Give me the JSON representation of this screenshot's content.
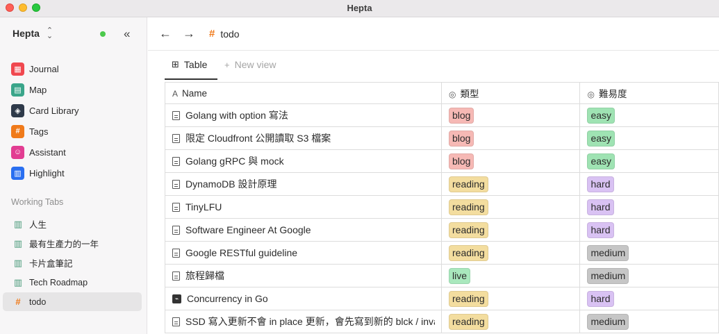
{
  "window": {
    "title": "Hepta"
  },
  "sidebar": {
    "workspace": "Hepta",
    "nav": [
      {
        "label": "Journal",
        "icon": "calendar-icon",
        "color": "#f0484f",
        "glyph": "▦"
      },
      {
        "label": "Map",
        "icon": "map-icon",
        "color": "#3aa58a",
        "glyph": "▤"
      },
      {
        "label": "Card Library",
        "icon": "stack-icon",
        "color": "#2f3a4a",
        "glyph": "◈"
      },
      {
        "label": "Tags",
        "icon": "hash-icon",
        "color": "#f07a1a",
        "glyph": "#"
      },
      {
        "label": "Assistant",
        "icon": "assistant-icon",
        "color": "#e23d92",
        "glyph": "☺"
      },
      {
        "label": "Highlight",
        "icon": "highlight-icon",
        "color": "#2a6ff0",
        "glyph": "▥"
      }
    ],
    "working_tabs_title": "Working Tabs",
    "working_tabs": [
      {
        "label": "人生",
        "icon": "map-icon"
      },
      {
        "label": "最有生產力的一年",
        "icon": "map-icon"
      },
      {
        "label": "卡片盒筆記",
        "icon": "map-icon"
      },
      {
        "label": "Tech Roadmap",
        "icon": "map-icon"
      },
      {
        "label": "todo",
        "icon": "hash-icon"
      }
    ]
  },
  "header": {
    "breadcrumb": "todo"
  },
  "tabs": {
    "table": "Table",
    "new_view": "New view"
  },
  "table": {
    "columns": [
      "Name",
      "類型",
      "難易度"
    ],
    "rows": [
      {
        "name": "Golang with option 寫法",
        "type": "blog",
        "difficulty": "easy",
        "icon": "doc"
      },
      {
        "name": "限定 Cloudfront 公開讀取 S3 檔案",
        "type": "blog",
        "difficulty": "easy",
        "icon": "doc"
      },
      {
        "name": "Golang gRPC 與 mock",
        "type": "blog",
        "difficulty": "easy",
        "icon": "doc"
      },
      {
        "name": "DynamoDB 設計原理",
        "type": "reading",
        "difficulty": "hard",
        "icon": "doc"
      },
      {
        "name": "TinyLFU",
        "type": "reading",
        "difficulty": "hard",
        "icon": "doc"
      },
      {
        "name": "Software Engineer At Google",
        "type": "reading",
        "difficulty": "hard",
        "icon": "doc"
      },
      {
        "name": "Google RESTful guideline",
        "type": "reading",
        "difficulty": "medium",
        "icon": "doc"
      },
      {
        "name": "旅程歸檔",
        "type": "live",
        "difficulty": "medium",
        "icon": "doc"
      },
      {
        "name": "Concurrency in Go",
        "type": "reading",
        "difficulty": "hard",
        "icon": "pdf"
      },
      {
        "name": "SSD 寫入更新不會 in place 更新，會先寫到新的 blck / invalidate",
        "type": "reading",
        "difficulty": "medium",
        "icon": "doc"
      }
    ]
  },
  "tag_colors": {
    "blog": "#f6b9b5",
    "reading": "#f3dd9f",
    "live": "#a9e8bd",
    "easy": "#9fe3b3",
    "hard": "#d9c2f3",
    "medium": "#c6c6c6"
  }
}
